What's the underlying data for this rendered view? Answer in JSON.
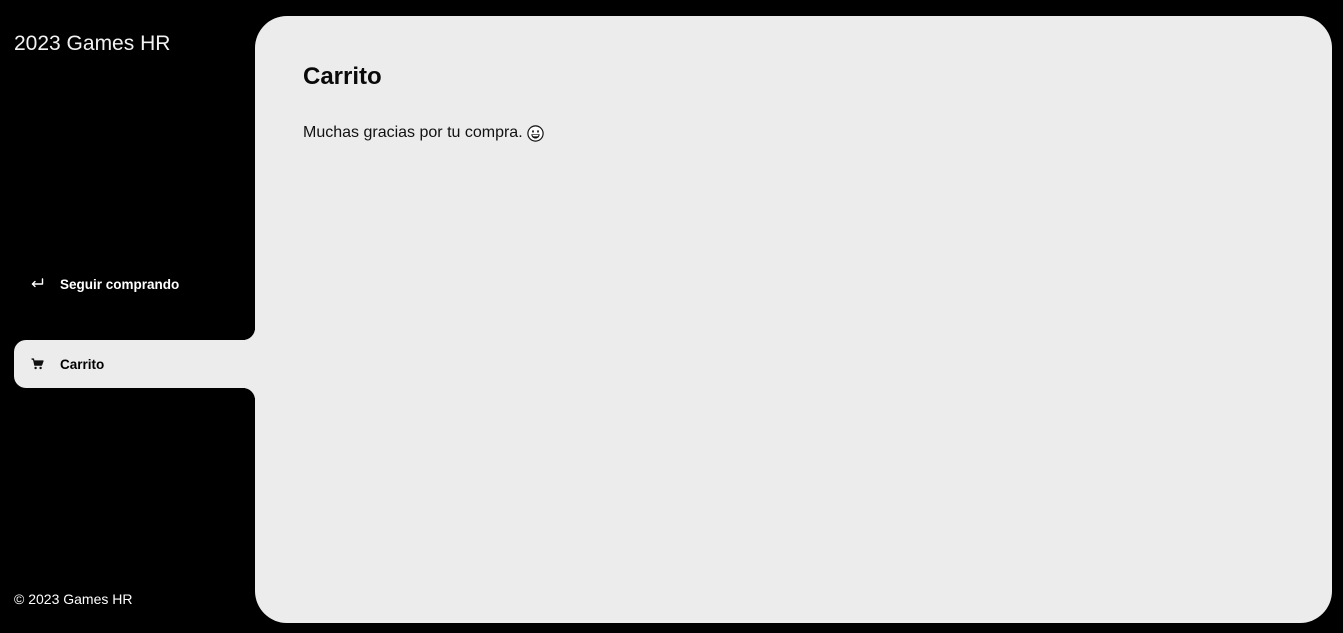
{
  "sidebar": {
    "brand": "2023 Games HR",
    "nav": [
      {
        "label": "Seguir comprando",
        "icon": "return-arrow-icon",
        "active": false
      },
      {
        "label": "Carrito",
        "icon": "shopping-cart-icon",
        "active": true
      }
    ],
    "footer": "© 2023 Games HR"
  },
  "main": {
    "title": "Carrito",
    "message": "Muchas gracias por tu compra.",
    "message_icon": "grinning-face-icon"
  },
  "colors": {
    "background": "#000000",
    "panel": "#ececec",
    "text_light": "#ffffff",
    "text_dark": "#000000"
  }
}
